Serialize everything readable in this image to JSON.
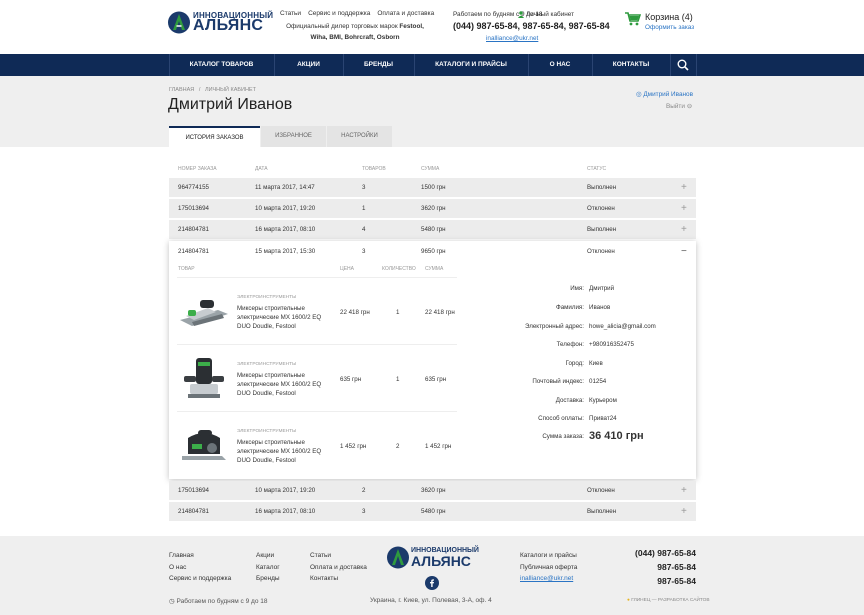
{
  "header": {
    "logo_line1": "ИННОВАЦИОННЫЙ",
    "logo_line2": "АЛЬЯНС",
    "top_links": [
      "Статьи",
      "Сервис и поддержка",
      "Оплата и доставка"
    ],
    "dealer_line1": "Официальный дилер торговых марок ",
    "dealer_brand1": "Festool,",
    "dealer_line2": "Wiha, BMI, Bohrcraft, Osborn",
    "work_hours": "Работаем по будням с 9 до 18",
    "cabinet": "Личный кабинет",
    "phones": "(044) 987-65-84, 987-65-84, 987-65-84",
    "email": "inalliance@ukr.net",
    "cart_label": "Корзина (4)",
    "checkout_link": "Оформить заказ"
  },
  "nav": {
    "items": [
      "КАТАЛОГ ТОВАРОВ",
      "АКЦИИ",
      "БРЕНДЫ",
      "КАТАЛОГИ И ПРАЙСЫ",
      "О НАС",
      "КОНТАКТЫ"
    ],
    "search_icon": "search-icon"
  },
  "page": {
    "breadcrumb_home": "ГЛАВНАЯ",
    "breadcrumb_sep": "/",
    "breadcrumb_current": "ЛИЧНЫЙ КАБИНЕТ",
    "title": "Дмитрий Иванов",
    "user_name": "Дмитрий Иванов",
    "logout": "Выйти",
    "tabs": [
      "ИСТОРИЯ ЗАКАЗОВ",
      "ИЗБРАННОЕ",
      "НАСТРОЙКИ"
    ]
  },
  "orders": {
    "headers": [
      "НОМЕР ЗАКАЗА",
      "ДАТА",
      "ТОВАРОВ",
      "СУММА",
      "СТАТУС"
    ],
    "rows": [
      {
        "num": "964774155",
        "date": "11 марта 2017, 14:47",
        "qty": "3",
        "sum": "1500 грн",
        "status": "Выполнен"
      },
      {
        "num": "175013694",
        "date": "10 марта 2017, 19:20",
        "qty": "1",
        "sum": "3620 грн",
        "status": "Отклонен"
      },
      {
        "num": "214804781",
        "date": "16 марта 2017, 08:10",
        "qty": "4",
        "sum": "5480 грн",
        "status": "Выполнен"
      }
    ],
    "expanded": {
      "num": "214804781",
      "date": "15 марта 2017, 15:30",
      "qty": "3",
      "sum": "9650 грн",
      "status": "Отклонен"
    },
    "rows_after": [
      {
        "num": "175013694",
        "date": "10 марта 2017, 19:20",
        "qty": "2",
        "sum": "3620 грн",
        "status": "Отклонен"
      },
      {
        "num": "214804781",
        "date": "16 марта 2017, 08:10",
        "qty": "3",
        "sum": "5480 грн",
        "status": "Выполнен"
      }
    ],
    "plus": "+",
    "minus": "−"
  },
  "details": {
    "sub_headers": [
      "ТОВАР",
      "ЦЕНА",
      "КОЛИЧЕСТВО",
      "СУММА"
    ],
    "products": [
      {
        "cat": "ЭЛЕКТРОИНСТРУМЕНТЫ",
        "name": "Миксеры строительные электрические MX 1600/2 EQ DUO Doudle, Festool",
        "price": "22 418 грн",
        "qty": "1",
        "sum": "22 418 грн"
      },
      {
        "cat": "ЭЛЕКТРОИНСТРУМЕНТЫ",
        "name": "Миксеры строительные электрические MX 1600/2 EQ DUO Doudle, Festool",
        "price": "635 грн",
        "qty": "1",
        "sum": "635 грн"
      },
      {
        "cat": "ЭЛЕКТРОИНСТРУМЕНТЫ",
        "name": "Миксеры строительные электрические MX 1600/2 EQ DUO Doudle, Festool",
        "price": "1 452 грн",
        "qty": "2",
        "sum": "1 452 грн"
      }
    ],
    "info": [
      {
        "label": "Имя:",
        "value": "Дмитрий"
      },
      {
        "label": "Фамилия:",
        "value": "Иванов"
      },
      {
        "label": "Электронный адрес:",
        "value": "howe_alicia@gmail.com"
      },
      {
        "label": "Телефон:",
        "value": "+980916352475"
      },
      {
        "label": "Город:",
        "value": "Киев"
      },
      {
        "label": "Почтовый индекс:",
        "value": "01254"
      },
      {
        "label": "Доставка:",
        "value": "Курьером"
      },
      {
        "label": "Способ оплаты:",
        "value": "Приват24"
      }
    ],
    "total_label": "Сумма заказа:",
    "total_value": "36 410 грн"
  },
  "footer": {
    "col1": [
      "Главная",
      "О нас",
      "Сервис и поддержка"
    ],
    "col2": [
      "Акции",
      "Каталог",
      "Бренды"
    ],
    "col3": [
      "Статьи",
      "Оплата и доставка",
      "Контакты"
    ],
    "col4": [
      "Каталоги и прайсы",
      "Публичная оферта"
    ],
    "email": "inalliance@ukr.net",
    "phones": [
      "(044) 987-65-84",
      "987-65-84",
      "987-65-84"
    ],
    "work_hours": "Работаем по будням с 9 до 18",
    "address": "Украина, г. Киев, ул. Полевая, 3-А, оф. 4",
    "dev_credit": "ГЛИНЕЦ — РАЗРАБОТКА САЙТОВ",
    "logo_line1": "ИННОВАЦИОННЫЙ",
    "logo_line2": "АЛЬЯНС"
  },
  "colors": {
    "navy": "#0f2a56",
    "green": "#2e9a3e",
    "link": "#2a74c4"
  }
}
